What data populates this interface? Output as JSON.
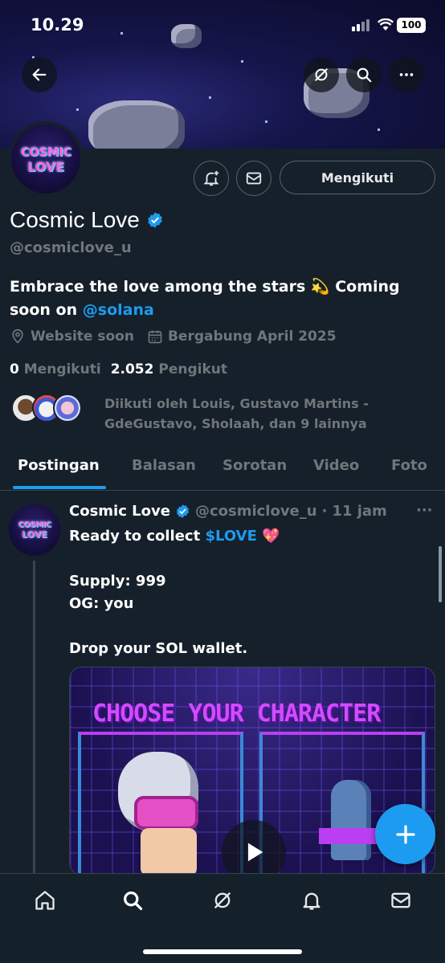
{
  "status_bar": {
    "time": "10.29",
    "battery": "100"
  },
  "profile": {
    "name": "Cosmic Love",
    "handle": "@cosmiclove_u",
    "logo_line1": "COSMIC",
    "logo_line2": "LOVE",
    "bio_text": "Embrace the love among the stars 💫 Coming soon on ",
    "bio_link": "@solana",
    "website": "Website soon",
    "joined": "Bergabung April 2025",
    "following_count": "0",
    "following_label": "Mengikuti",
    "followers_count": "2.052",
    "followers_label": "Pengikut",
    "followed_by": "Diikuti oleh Louis, Gustavo Martins - GdeGustavo, Sholaah, dan 9 lainnya",
    "follow_button": "Mengikuti"
  },
  "tabs": [
    {
      "label": "Postingan",
      "active": true
    },
    {
      "label": "Balasan"
    },
    {
      "label": "Sorotan"
    },
    {
      "label": "Video"
    },
    {
      "label": "Foto"
    }
  ],
  "post": {
    "author": "Cosmic Love",
    "handle": "@cosmiclove_u",
    "sep": "·",
    "time": "11 jam",
    "more": "···",
    "line1_text": "Ready to collect ",
    "line1_link": "$LOVE",
    "line1_emoji": " 💖",
    "line2": "Supply: 999",
    "line3": "OG: you",
    "line4": "Drop your SOL wallet.",
    "media_title": "CHOOSE YOUR CHARACTER"
  },
  "colors": {
    "accent": "#1d9bf0",
    "background": "#15202b",
    "muted": "#71767b",
    "media_magenta": "#d24bff"
  },
  "icons": [
    "back-arrow-icon",
    "grok-icon",
    "search-icon",
    "more-icon",
    "notification-add-icon",
    "mail-icon",
    "location-icon",
    "calendar-icon",
    "verified-icon",
    "play-icon",
    "plus-icon",
    "home-icon",
    "notifications-icon"
  ]
}
